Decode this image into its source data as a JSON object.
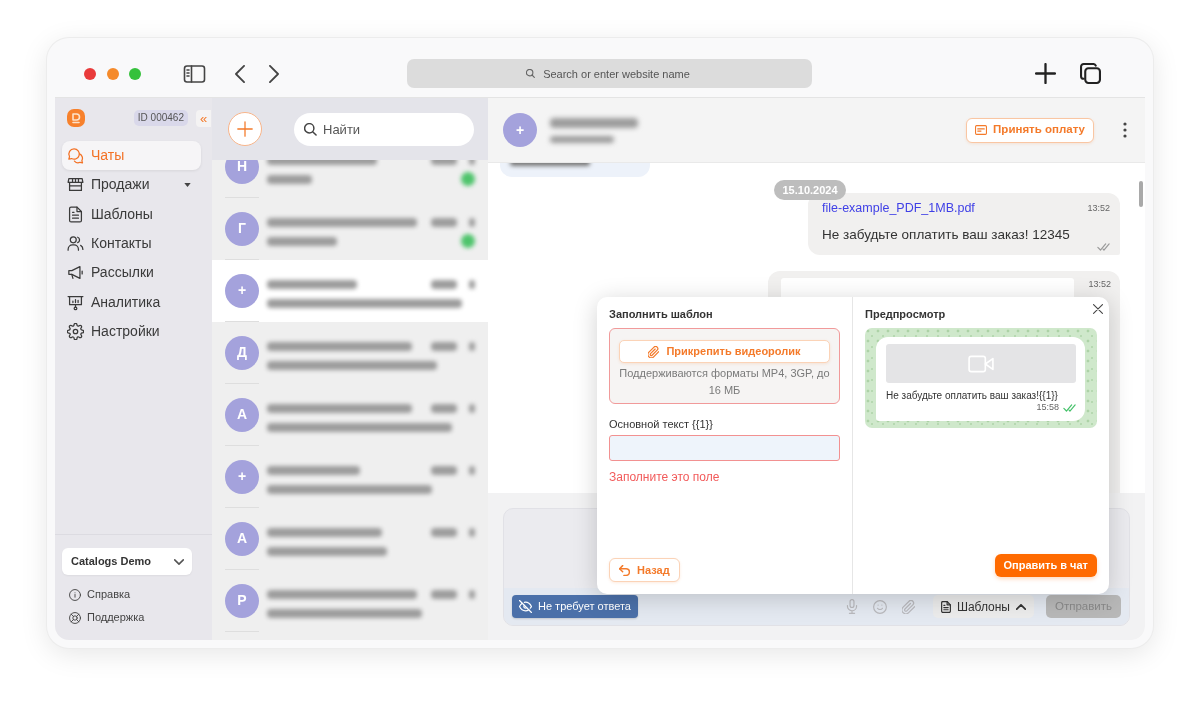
{
  "browser": {
    "address_bar": {
      "placeholder": "Search or enter website name"
    }
  },
  "sidebar": {
    "account_id": "ID 000462",
    "collapse_button": "«",
    "items": [
      {
        "label": "Чаты",
        "kind": "link",
        "selected": true
      },
      {
        "label": "Продажи",
        "kind": "group",
        "selected": false
      },
      {
        "label": "Шаблоны",
        "kind": "link",
        "selected": false
      },
      {
        "label": "Контакты",
        "kind": "link",
        "selected": false
      },
      {
        "label": "Рассылки",
        "kind": "link",
        "selected": false
      },
      {
        "label": "Аналитика",
        "kind": "link",
        "selected": false
      },
      {
        "label": "Настройки",
        "kind": "link",
        "selected": false
      }
    ],
    "workspace_select": {
      "value": "Catalogs Demo"
    },
    "footer_links": [
      {
        "label": "Справка"
      },
      {
        "label": "Поддержка"
      }
    ]
  },
  "chat_list": {
    "search": {
      "placeholder": "Найти"
    },
    "chats": [
      {
        "avatar": "Н",
        "selected": false,
        "unread": true
      },
      {
        "avatar": "Г",
        "selected": false,
        "unread": true
      },
      {
        "avatar": "+",
        "selected": true,
        "unread": false
      },
      {
        "avatar": "Д",
        "selected": false,
        "unread": false
      },
      {
        "avatar": "А",
        "selected": false,
        "unread": false
      },
      {
        "avatar": "+",
        "selected": false,
        "unread": false
      },
      {
        "avatar": "А",
        "selected": false,
        "unread": false
      },
      {
        "avatar": "Р",
        "selected": false,
        "unread": false
      }
    ]
  },
  "chat": {
    "header": {
      "avatar": "+",
      "pay_button": "Принять оплату"
    },
    "messages": [
      {
        "kind": "blurred"
      },
      {
        "kind": "date",
        "text": "15.10.2024"
      },
      {
        "kind": "file",
        "file_name": "file-example_PDF_1MB.pdf",
        "time": "13:52",
        "text": "Не забудьте оплатить ваш заказ! 12345",
        "read": false
      },
      {
        "kind": "media",
        "time": "13:52"
      }
    ],
    "composer": {
      "no_reply_button": "Не требует ответа",
      "templates_button": {
        "label": "Шаблоны",
        "expanded": true
      },
      "send_button": {
        "label": "Отправить",
        "disabled": true
      }
    }
  },
  "template_popup": {
    "title": "Заполнить шаблон",
    "attachment": {
      "button": "Прикрепить видеоролик",
      "hint": "Поддерживаются форматы MP4, 3GP, до 16 МБ",
      "invalid": true
    },
    "field": {
      "label": "Основной текст {{1}}",
      "invalid": true,
      "error": "Заполните это поле"
    },
    "back_button": "Назад",
    "preview": {
      "title": "Предпросмотр",
      "text": "Не забудьте оплатить ваш заказ!{{1}}",
      "time": "15:58",
      "read": true
    },
    "send_button": "Оправить в чат"
  }
}
